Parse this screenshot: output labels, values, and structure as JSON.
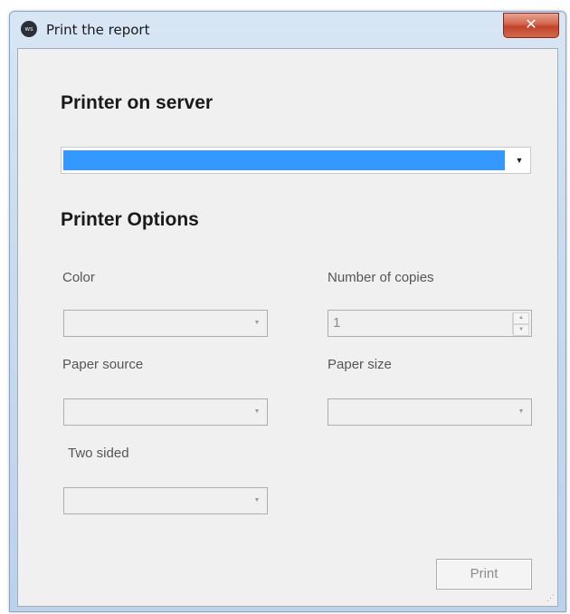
{
  "window": {
    "title": "Print the report",
    "icon_text": "ws",
    "close_label": "✕"
  },
  "printer_server": {
    "heading": "Printer on server",
    "selected_value": "",
    "selection_color": "#3399ff"
  },
  "options": {
    "heading": "Printer Options",
    "color_label": "Color",
    "color_value": "",
    "copies_label": "Number of copies",
    "copies_value": "1",
    "paper_source_label": "Paper source",
    "paper_source_value": "",
    "paper_size_label": "Paper size",
    "paper_size_value": "",
    "two_sided_label": "Two sided",
    "two_sided_value": ""
  },
  "actions": {
    "print_label": "Print"
  },
  "colors": {
    "close_button": "#c0432a",
    "dialog_background": "#f0f0f0",
    "titlebar": "#c9dbee"
  }
}
